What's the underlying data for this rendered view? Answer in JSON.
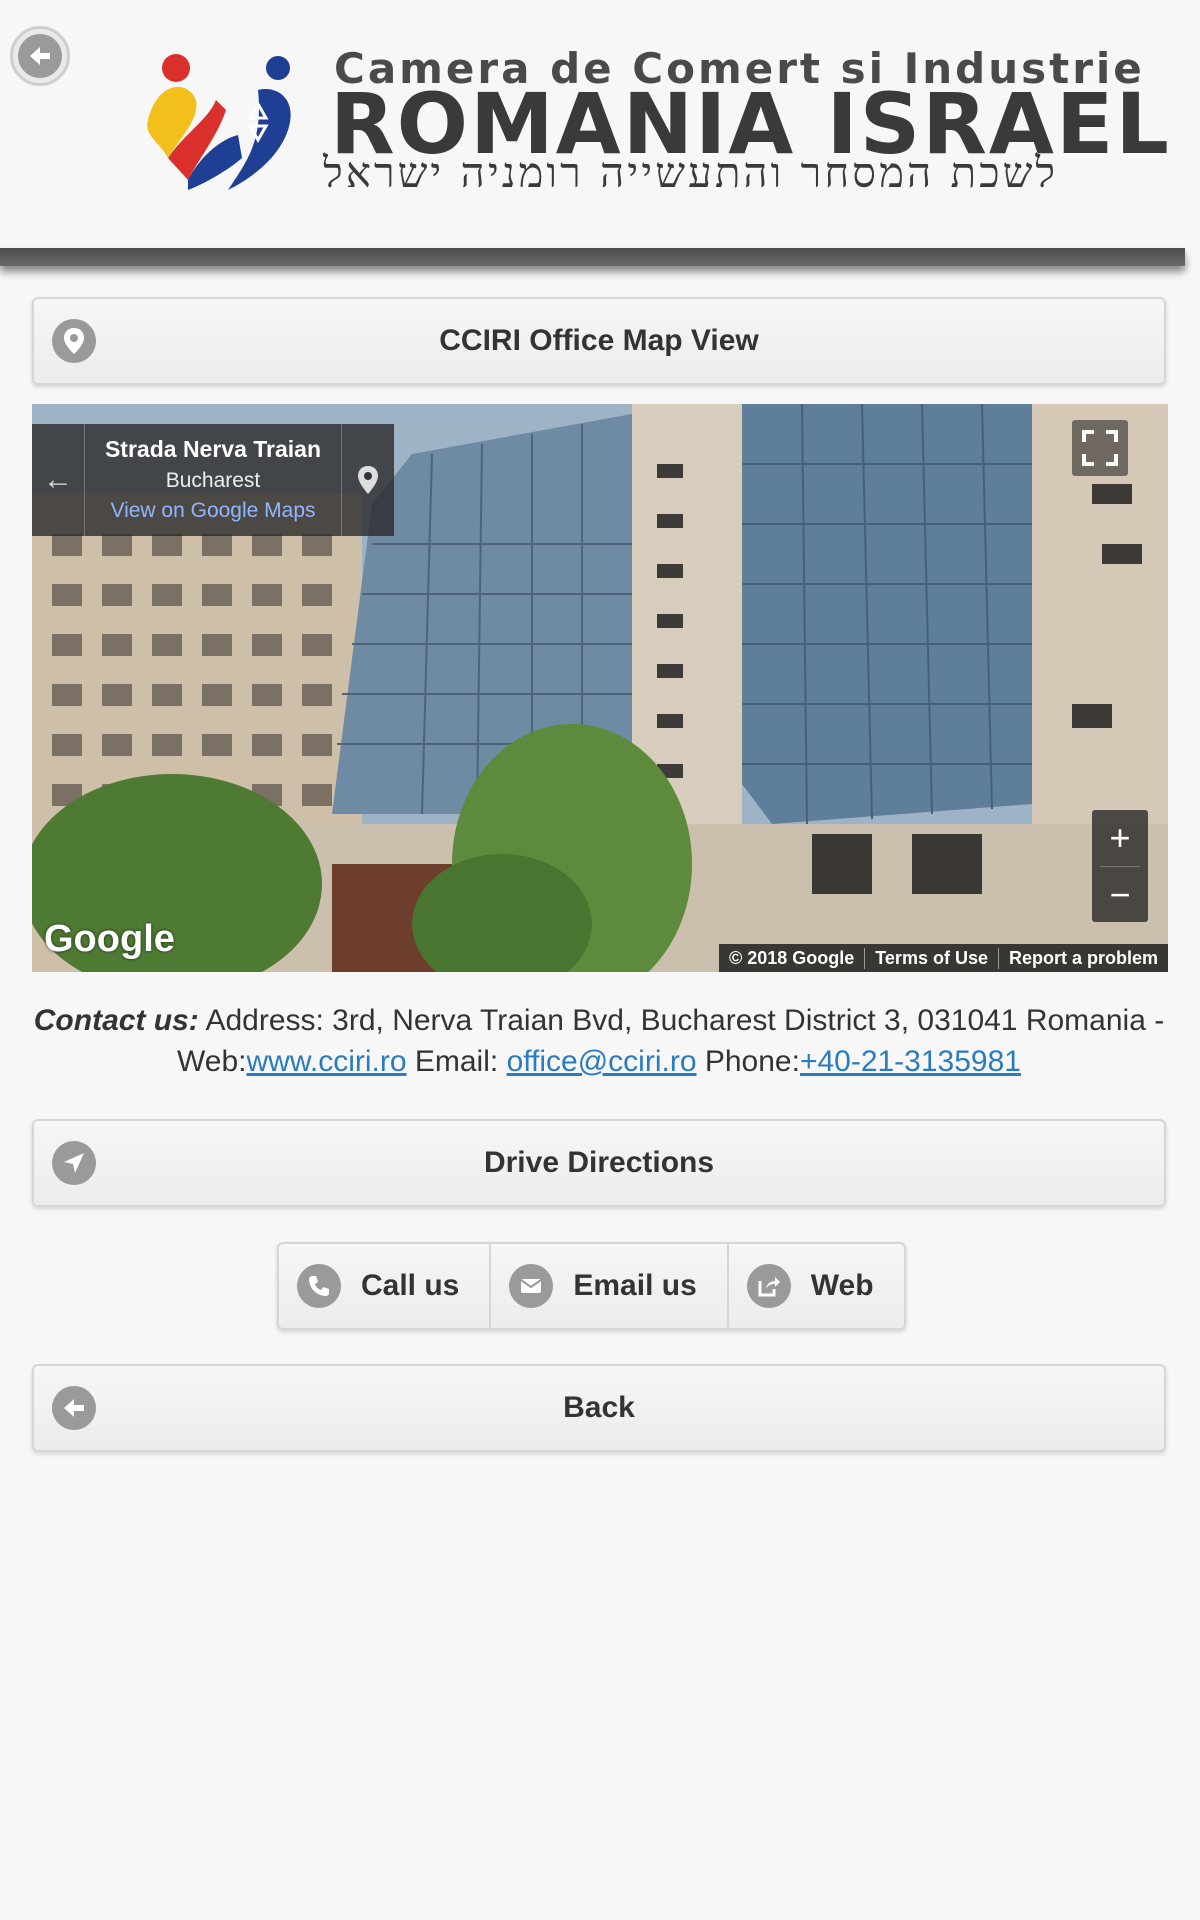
{
  "header": {
    "logo_line1": "Camera de Comert si Industrie",
    "logo_line2": "ROMANIA ISRAEL",
    "logo_line3": "לשכת המסחר והתעשייה רומניה ישראל",
    "back_icon": "arrow-left-icon"
  },
  "map_view_button": {
    "label": "CCIRI Office Map View",
    "icon": "map-pin-icon"
  },
  "streetview": {
    "street": "Strada Nerva Traian",
    "city": "Bucharest",
    "link": "View on Google Maps",
    "google_logo": "Google",
    "copyright": "© 2018 Google",
    "terms": "Terms of Use",
    "report": "Report a problem",
    "zoom_in": "+",
    "zoom_out": "−"
  },
  "contact": {
    "heading": "Contact us:",
    "address": " Address: 3rd, Nerva Traian Bvd, Bucharest District 3, 031041 Romania - Web:",
    "web": "www.cciri.ro",
    "email_label": " Email: ",
    "email": "office@cciri.ro",
    "phone_label": " Phone:",
    "phone": "+40-21-3135981"
  },
  "directions_button": {
    "label": "Drive Directions",
    "icon": "navigation-arrow-icon"
  },
  "actions": [
    {
      "label": "Call us",
      "icon": "phone-icon"
    },
    {
      "label": "Email us",
      "icon": "envelope-icon"
    },
    {
      "label": "Web",
      "icon": "share-icon"
    }
  ],
  "back_button": {
    "label": "Back",
    "icon": "arrow-left-icon"
  },
  "colors": {
    "accent": "#2b7bc0",
    "icon_bg": "#9a9a9a",
    "background": "#f7f7f7"
  }
}
